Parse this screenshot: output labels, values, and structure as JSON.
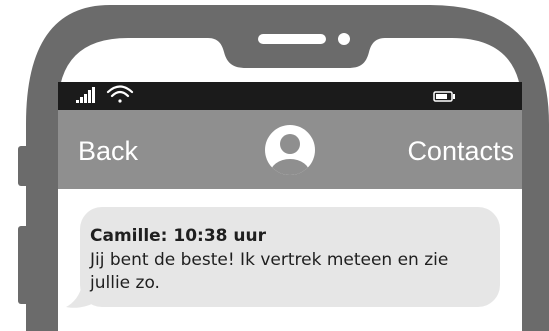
{
  "nav": {
    "back_label": "Back",
    "contacts_label": "Contacts"
  },
  "status_bar": {
    "icons": [
      "signal-icon",
      "wifi-icon",
      "battery-icon"
    ]
  },
  "message": {
    "sender_time": "Camille: 10:38 uur",
    "text": "Jij bent de beste! Ik vertrek meteen en zie jullie zo."
  },
  "colors": {
    "phone_body": "#6b6b6b",
    "status_bar": "#1b1b1b",
    "nav_bar": "#8f8f8f",
    "bubble": "#e6e6e6",
    "text": "#1f1f1f"
  }
}
